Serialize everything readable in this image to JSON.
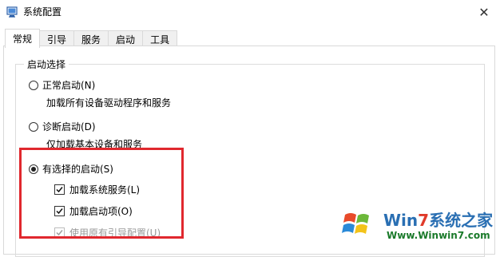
{
  "window": {
    "title": "系统配置",
    "close_glyph": "✕"
  },
  "tabs": [
    {
      "label": "常规",
      "active": true
    },
    {
      "label": "引导",
      "active": false
    },
    {
      "label": "服务",
      "active": false
    },
    {
      "label": "启动",
      "active": false
    },
    {
      "label": "工具",
      "active": false
    }
  ],
  "startup_selection": {
    "group_title": "启动选择",
    "normal": {
      "label": "正常启动(N)",
      "description": "加载所有设备驱动程序和服务",
      "selected": false
    },
    "diagnostic": {
      "label": "诊断启动(D)",
      "description": "仅加载基本设备和服务",
      "selected": false
    },
    "selective": {
      "label": "有选择的启动(S)",
      "selected": true,
      "options": {
        "load_system_services": {
          "label": "加载系统服务(L)",
          "checked": true,
          "enabled": true
        },
        "load_startup_items": {
          "label": "加载启动项(O)",
          "checked": true,
          "enabled": true
        },
        "use_original_boot_config": {
          "label": "使用原有引导配置(U)",
          "checked": true,
          "enabled": false
        }
      }
    }
  },
  "annotation": {
    "highlight_color": "#e0282e"
  },
  "watermark": {
    "brand_prefix": "Win",
    "brand_seven": "7",
    "brand_suffix": "系统之家",
    "url": "Www.Winwin7.com",
    "logo_icon": "windows-logo-icon"
  }
}
